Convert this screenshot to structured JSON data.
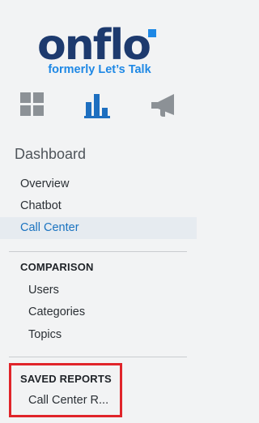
{
  "logo": {
    "wordmark": "onflo",
    "tagline": "formerly Let’s Talk",
    "colors": {
      "wordmark": "#1d3a6e",
      "accent": "#1e88e5"
    }
  },
  "icons": [
    {
      "name": "grid-icon",
      "active": false
    },
    {
      "name": "bar-chart-icon",
      "active": true
    },
    {
      "name": "megaphone-icon",
      "active": false
    }
  ],
  "dashboard": {
    "title": "Dashboard",
    "items": [
      "Overview",
      "Chatbot",
      "Call Center"
    ],
    "active_item": "Call Center"
  },
  "comparison": {
    "heading": "COMPARISON",
    "items": [
      "Users",
      "Categories",
      "Topics"
    ]
  },
  "saved_reports": {
    "heading": "SAVED REPORTS",
    "items": [
      "Call Center R..."
    ]
  },
  "colors": {
    "active_text": "#1a73c0",
    "highlight_border": "#e0242a"
  }
}
